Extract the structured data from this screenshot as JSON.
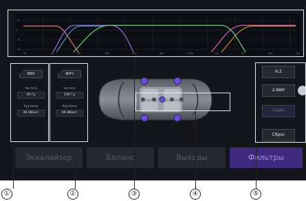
{
  "channel1": {
    "header": "ФВЧ",
    "freq_label": "Частота",
    "freq_value": "40 Гц",
    "slope_label": "Крутизна",
    "slope_value": "48 dB/окт"
  },
  "channel2": {
    "header": "ФНЧ",
    "freq_label": "Частота",
    "freq_value": "100 Гц",
    "slope_label": "Крутизна",
    "slope_value": "48 dB/окт"
  },
  "right_buttons": [
    "6.2",
    "2-WAY",
    "3-WAY",
    "Сброс"
  ],
  "tabs": [
    "Эквалайзер",
    "Баланс",
    "Выходы",
    "Фильтры"
  ],
  "active_tab": "Фильтры",
  "callouts": [
    "①",
    "②",
    "③",
    "④",
    "⑤"
  ],
  "graph": {
    "x_ticks": [
      "20",
      "40",
      "80",
      "160",
      "320",
      "640",
      "1.25k",
      "2.5k",
      "5k",
      "10k",
      "20k"
    ],
    "y_ticks": [
      "12",
      "0",
      "-12",
      "-24"
    ],
    "curve_colors": [
      "#8d6fe0",
      "#5aa9e0",
      "#e07b6a",
      "#6fd07a",
      "#e06ab0",
      "#e0a04a"
    ]
  },
  "colors": {
    "accent": "#6b4fd6",
    "frame": "#e9ecf2"
  }
}
